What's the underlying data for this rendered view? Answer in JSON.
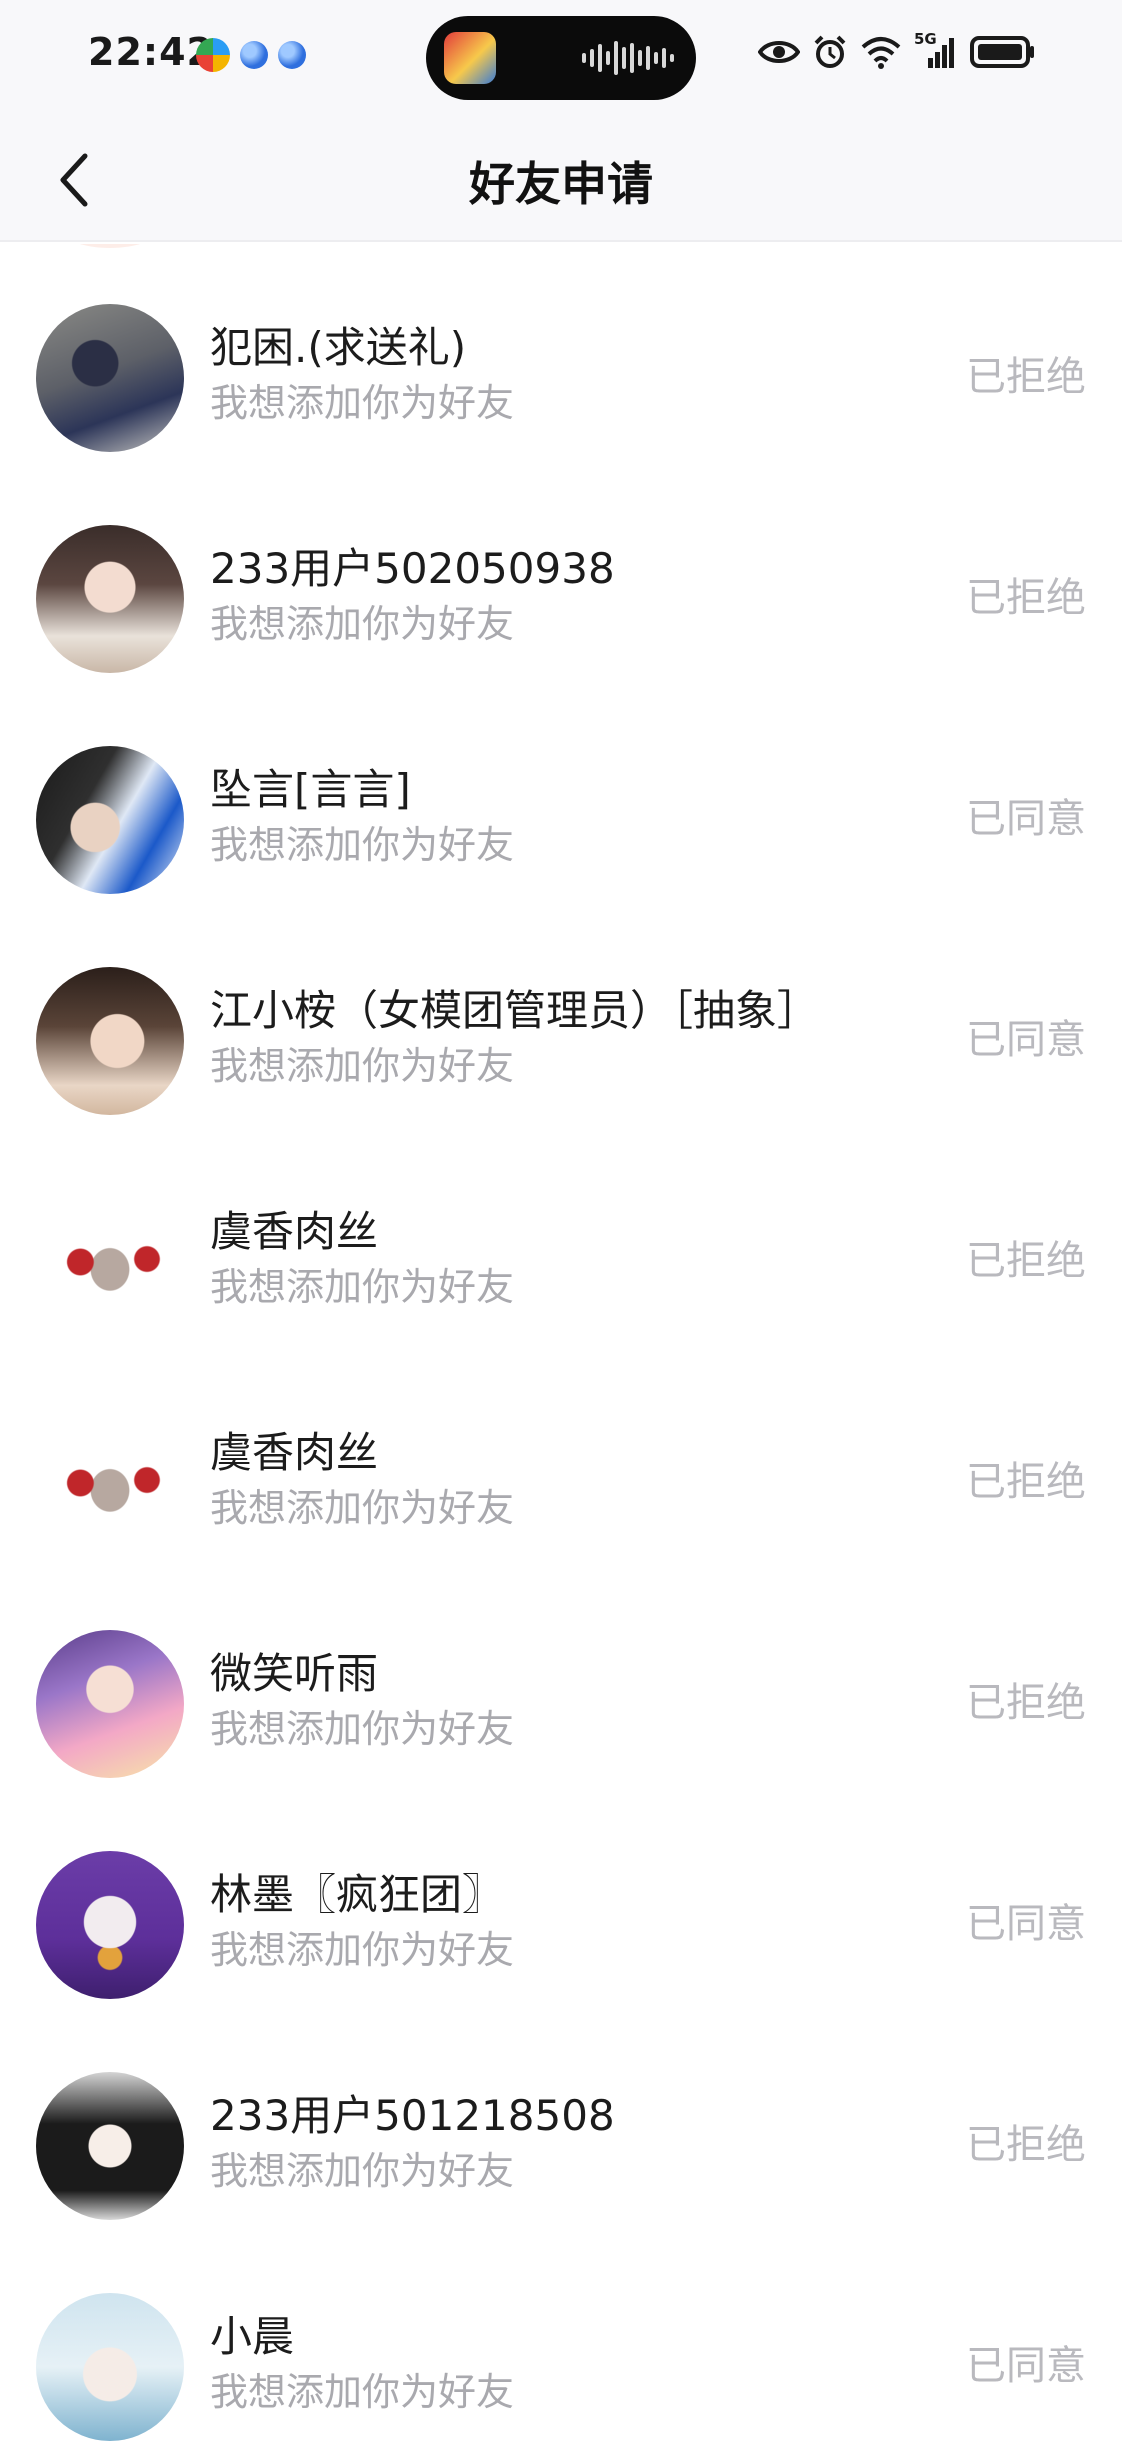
{
  "status_bar": {
    "time": "22:42",
    "network_label": "5G",
    "icons": [
      "app-notification-icon",
      "browser-notification-icon",
      "browser-notification-icon",
      "eye-icon",
      "alarm-icon",
      "wifi-icon",
      "cellular-signal-icon",
      "battery-icon"
    ]
  },
  "header": {
    "title": "好友申请",
    "back_icon": "chevron-left-icon"
  },
  "requests": [
    {
      "name": "犯困.(求送礼)",
      "message": "我想添加你为好友",
      "status": "已拒绝"
    },
    {
      "name": "233用户502050938",
      "message": "我想添加你为好友",
      "status": "已拒绝"
    },
    {
      "name": "坠言[言言]",
      "message": "我想添加你为好友",
      "status": "已同意"
    },
    {
      "name": "江小桉（女模团管理员）［抽象］",
      "message": "我想添加你为好友",
      "status": "已同意"
    },
    {
      "name": "虞香肉丝",
      "message": "我想添加你为好友",
      "status": "已拒绝"
    },
    {
      "name": "虞香肉丝",
      "message": "我想添加你为好友",
      "status": "已拒绝"
    },
    {
      "name": "微笑听雨",
      "message": "我想添加你为好友",
      "status": "已拒绝"
    },
    {
      "name": "林墨〖疯狂团〗",
      "message": "我想添加你为好友",
      "status": "已同意"
    },
    {
      "name": "233用户501218508",
      "message": "我想添加你为好友",
      "status": "已拒绝"
    },
    {
      "name": "小晨",
      "message": "我想添加你为好友",
      "status": "已同意"
    }
  ]
}
